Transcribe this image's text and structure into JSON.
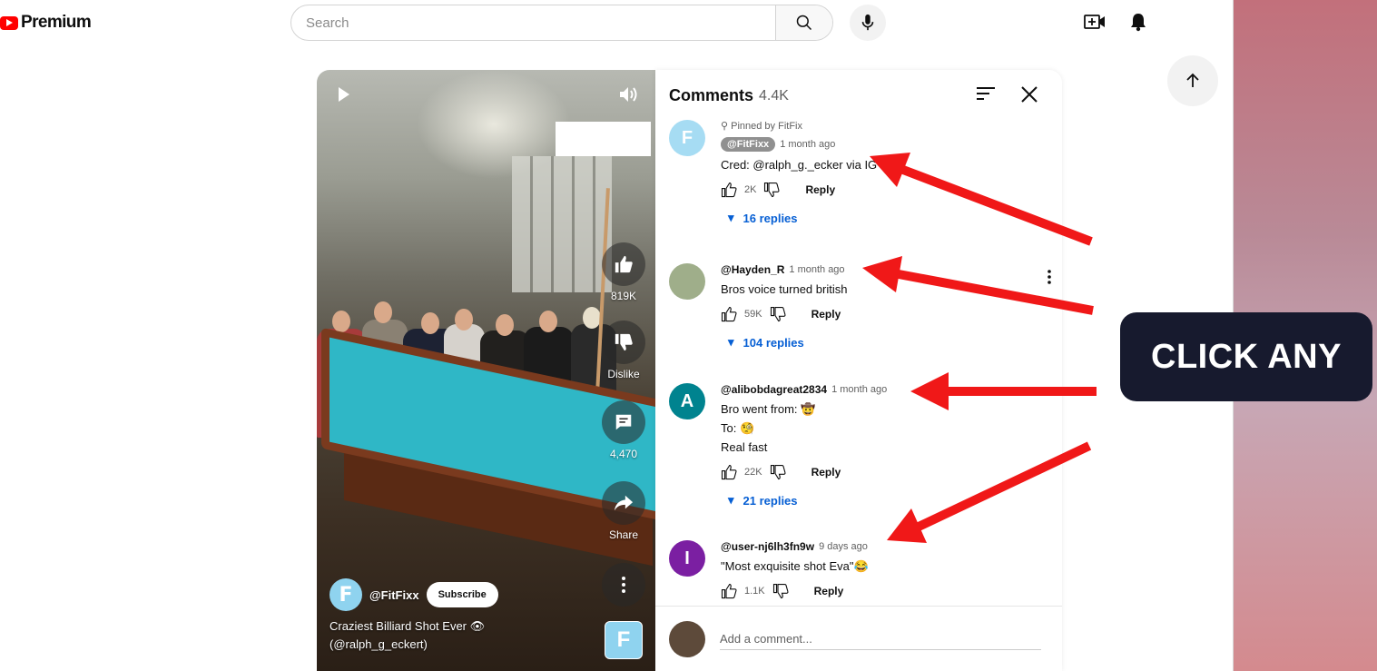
{
  "header": {
    "logo_text": "Premium",
    "search_placeholder": "Search"
  },
  "short": {
    "like_count": "819K",
    "dislike_label": "Dislike",
    "comment_count": "4,470",
    "share_label": "Share",
    "channel": "@FitFixx",
    "subscribe_label": "Subscribe",
    "title": "Craziest Billiard Shot Ever 👁 (@ralph_g_eckert)"
  },
  "comments": {
    "title": "Comments",
    "count": "4.4K",
    "items": [
      {
        "pinned": "Pinned by FitFix",
        "author": "@FitFixx",
        "time": "1 month ago",
        "text": "Cred: @ralph_g._ecker via IG",
        "likes": "2K",
        "reply": "Reply",
        "replies": "16 replies",
        "avatar_letter": "F",
        "avatar_color": "#a6dcf3"
      },
      {
        "author": "@Hayden_R",
        "time": "1 month ago",
        "text": "Bros voice turned british",
        "likes": "59K",
        "reply": "Reply",
        "replies": "104 replies",
        "avatar_color": "#9fae8a"
      },
      {
        "author": "@alibobdagreat2834",
        "time": "1 month ago",
        "text_lines": [
          "Bro went from: 🤠",
          "To: 🧐",
          "Real fast"
        ],
        "likes": "22K",
        "reply": "Reply",
        "replies": "21 replies",
        "avatar_letter": "A",
        "avatar_color": "#00838f"
      },
      {
        "author": "@user-nj6lh3fn9w",
        "time": "9 days ago",
        "text": "\"Most exquisite shot Eva\"😂",
        "likes": "1.1K",
        "reply": "Reply",
        "avatar_letter": "I",
        "avatar_color": "#7b1fa2"
      }
    ],
    "add_placeholder": "Add a comment..."
  },
  "overlay": {
    "cta_text": "CLICK ANY",
    "arrow_color": "#f01818"
  }
}
